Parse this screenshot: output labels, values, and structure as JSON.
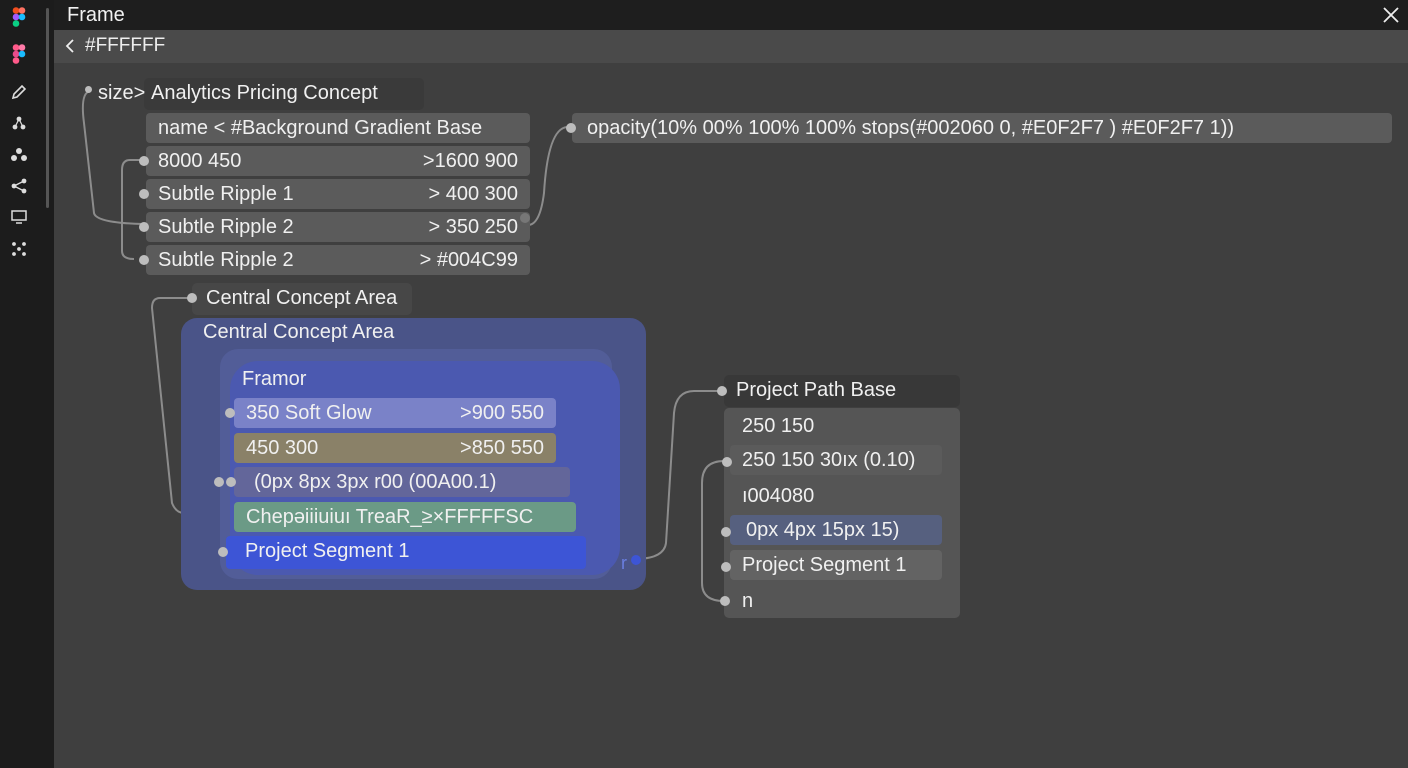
{
  "window": {
    "title": "Frame",
    "subtitle": "#FFFFFF"
  },
  "sidebar": {
    "icons": [
      "figma-logo-icon",
      "figma-logo-icon",
      "pencil-icon",
      "nodes-icon",
      "group-icon",
      "share-icon",
      "monitor-icon",
      "grid-dots-icon"
    ]
  },
  "node_size": {
    "header_key": "size>",
    "header_value": "Analytics Pricing Concept",
    "name_row": "name < #Background Gradient Base",
    "rows": [
      {
        "left": "8000 450",
        "right": ">1600 900"
      },
      {
        "left": "Subtle Ripple 1",
        "right": "> 400 300"
      },
      {
        "left": "Subtle Ripple 2",
        "right": "> 350 250"
      },
      {
        "left": "Subtle Ripple 2",
        "right": "> #004C99"
      }
    ]
  },
  "node_opacity": {
    "text": "opacity(10% 00% 100% 100% stops(#002060 0, #E0F2F7 ) #E0F2F7 1))"
  },
  "node_central": {
    "header": "Central Concept Area",
    "inner_title": "Central Concept Area",
    "group_title": "Framor",
    "rows": [
      {
        "left": "350 Soft Glow",
        "right": ">900 550",
        "color": "#7a82c8"
      },
      {
        "left": "450 300",
        "right": ">850 550",
        "color": "#8a8168"
      },
      {
        "left": "(0px 8px 3px r00 (00A00.1)",
        "right": "",
        "color": "#63669a"
      },
      {
        "left": "Chepəiiiuiuı TreaR_≥×FFFFFSC",
        "right": "",
        "color": "#6b9a86"
      },
      {
        "left": "Project Segment 1",
        "right": "",
        "color": "#3d55d6"
      }
    ],
    "footer_glyph": "r"
  },
  "node_path": {
    "header": "Project Path Base",
    "rows": [
      {
        "text": "250 150",
        "boxed": false
      },
      {
        "text": "250 150 30ıx (0.10)",
        "boxed": true
      },
      {
        "text": "ı004080",
        "boxed": false
      },
      {
        "text": "0px 4px 15px 15)",
        "boxed": true
      },
      {
        "text": "Project Segment 1",
        "boxed": true
      },
      {
        "text": "n",
        "boxed": false
      }
    ]
  },
  "colors": {
    "accent_blue": "#3d55d6",
    "panel": "#555555",
    "row": "#5b5b5b"
  }
}
